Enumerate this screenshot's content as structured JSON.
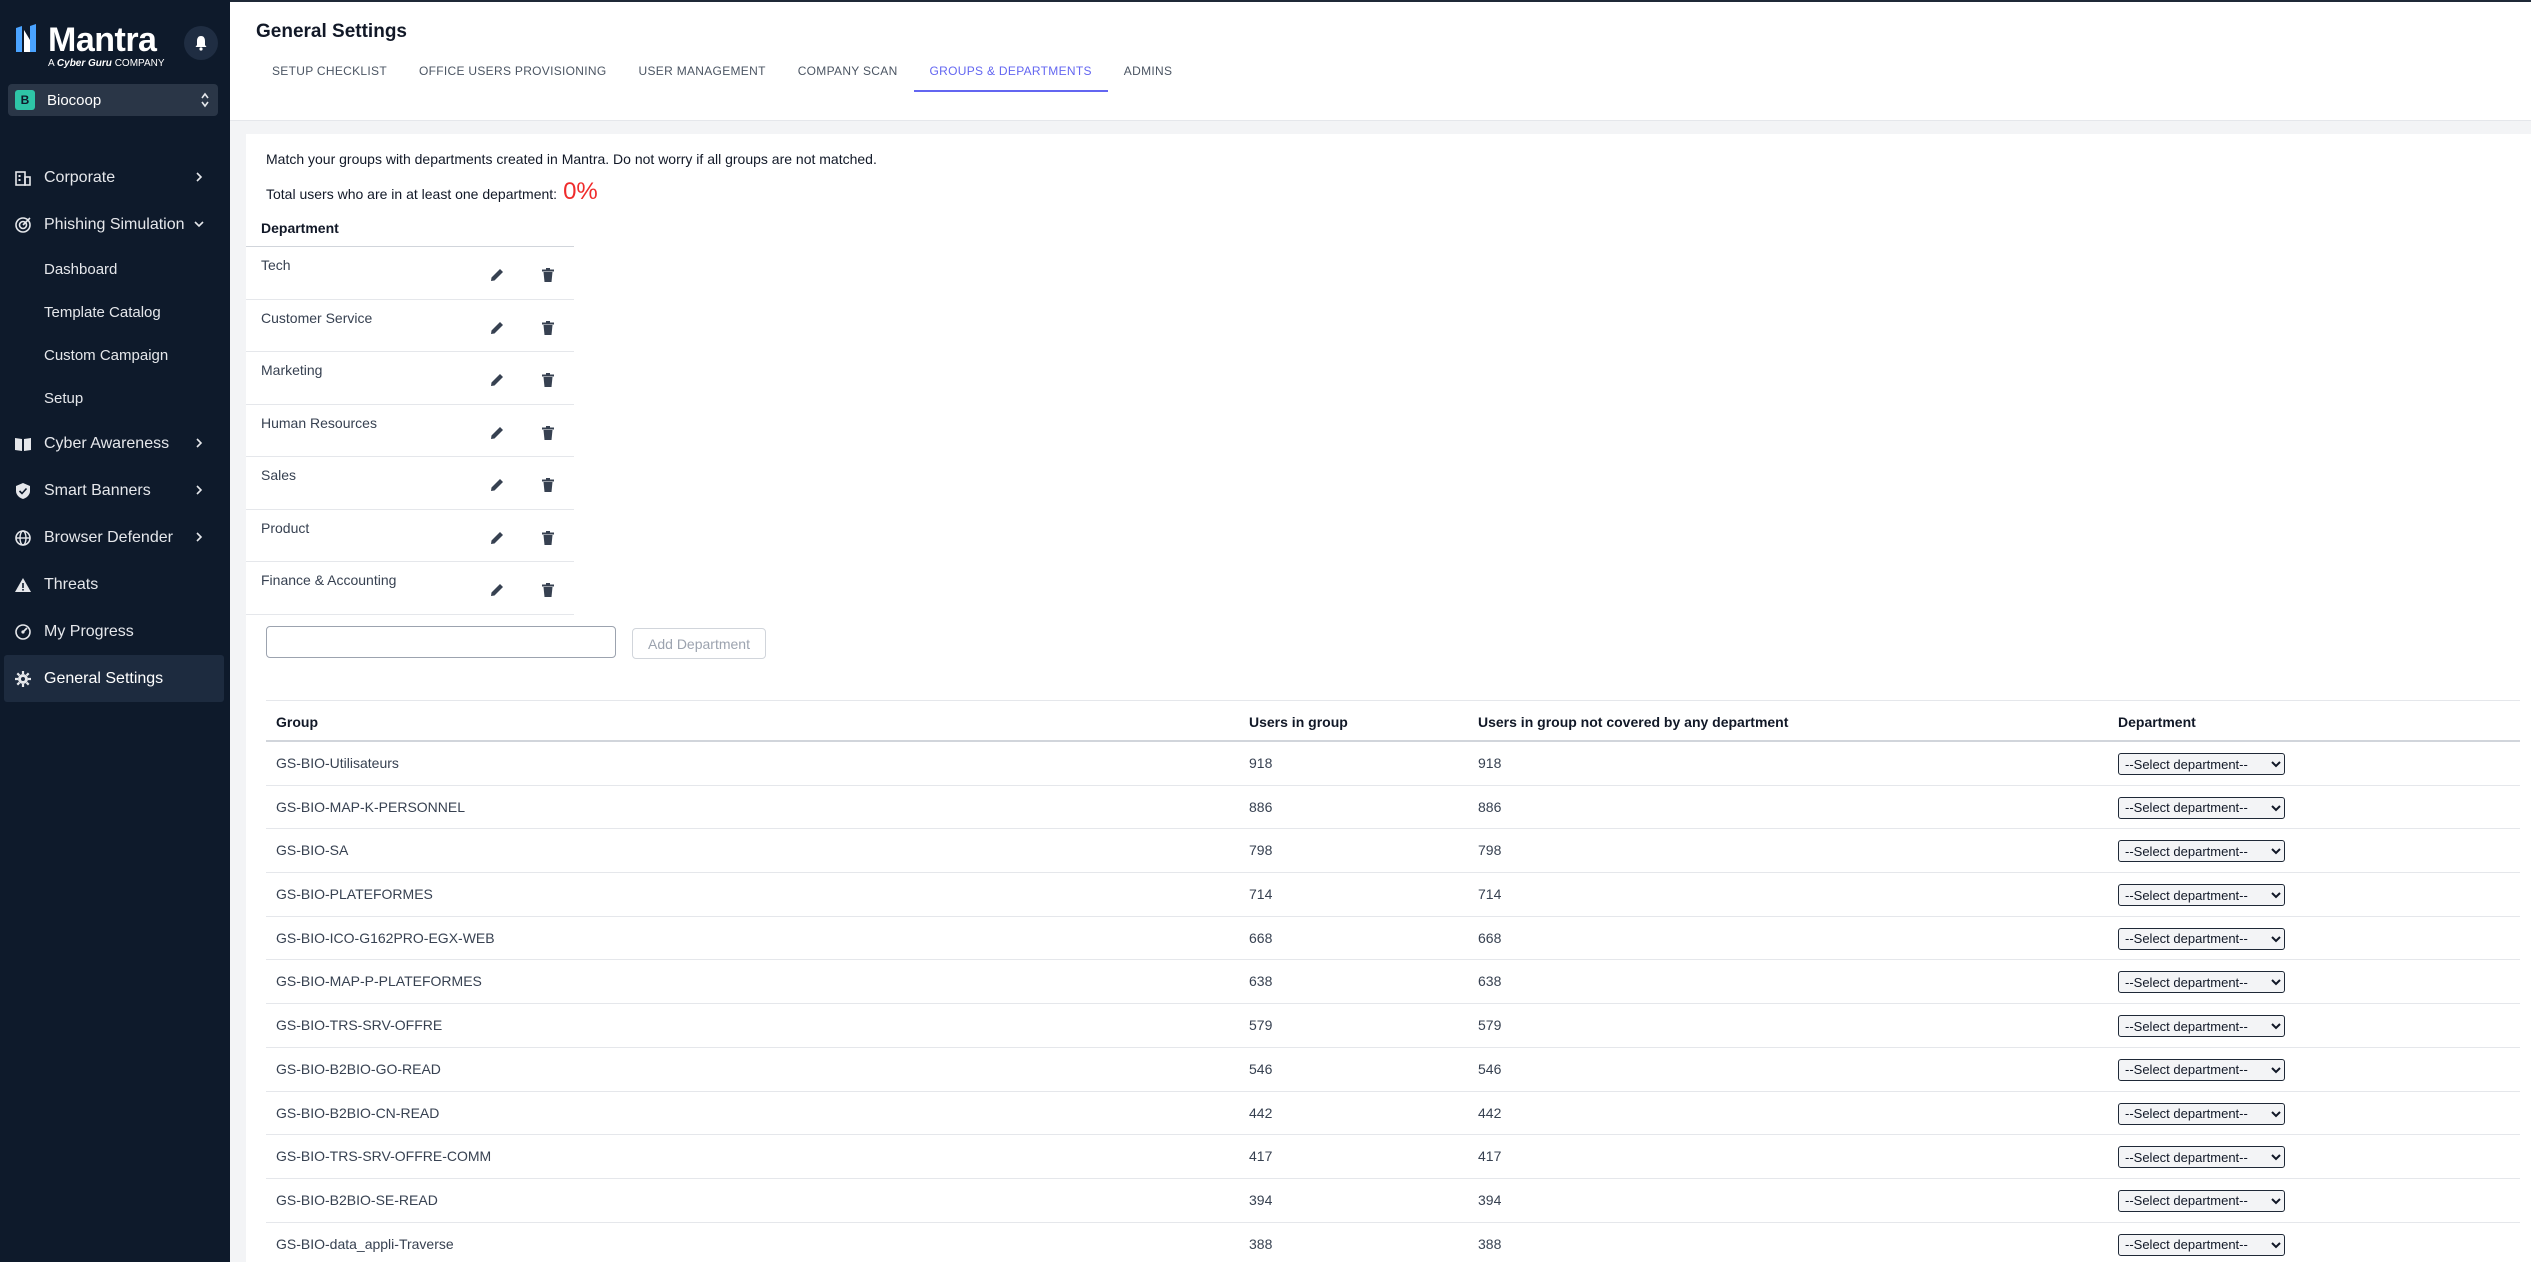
{
  "app": {
    "logo_text": "Mantra",
    "logo_sub_prefix": "A ",
    "logo_sub_brand": "Cyber Guru",
    "logo_sub_suffix": " COMPANY",
    "org": {
      "badge": "B",
      "name": "Biocoop"
    }
  },
  "colors": {
    "sidebar_bg": "#0e1a2b",
    "accent": "#6366f1",
    "percent_red": "#ef2b2b",
    "org_badge": "#2ec4a6"
  },
  "sidebar": {
    "items": [
      {
        "label": "Corporate",
        "icon": "building-icon"
      },
      {
        "label": "Phishing Simulation",
        "icon": "target-icon"
      },
      {
        "label": "Cyber Awareness",
        "icon": "book-icon"
      },
      {
        "label": "Smart Banners",
        "icon": "shield-icon"
      },
      {
        "label": "Browser Defender",
        "icon": "globe-icon"
      },
      {
        "label": "Threats",
        "icon": "warning-icon"
      },
      {
        "label": "My Progress",
        "icon": "progress-icon"
      },
      {
        "label": "General Settings",
        "icon": "gear-icon"
      }
    ],
    "phishing_sub": [
      "Dashboard",
      "Template Catalog",
      "Custom Campaign",
      "Setup"
    ]
  },
  "header": {
    "title": "General Settings",
    "tabs": [
      "SETUP CHECKLIST",
      "OFFICE USERS PROVISIONING",
      "USER MANAGEMENT",
      "COMPANY SCAN",
      "GROUPS & DEPARTMENTS",
      "ADMINS"
    ],
    "active_tab": "GROUPS & DEPARTMENTS"
  },
  "main": {
    "intro": "Match your groups with departments created in Mantra. Do not worry if all groups are not matched.",
    "total_label": "Total users who are in at least one department:",
    "total_value": "0%",
    "dept_header": "Department",
    "departments": [
      "Tech",
      "Customer Service",
      "Marketing",
      "Human Resources",
      "Sales",
      "Product",
      "Finance & Accounting"
    ],
    "add_input_value": "",
    "add_button": "Add Department",
    "groups_headers": [
      "Group",
      "Users in group",
      "Users in group not covered by any department",
      "Department"
    ],
    "select_placeholder": "--Select department--",
    "groups": [
      {
        "name": "GS-BIO-Utilisateurs",
        "users": "918",
        "uncovered": "918"
      },
      {
        "name": "GS-BIO-MAP-K-PERSONNEL",
        "users": "886",
        "uncovered": "886"
      },
      {
        "name": "GS-BIO-SA",
        "users": "798",
        "uncovered": "798"
      },
      {
        "name": "GS-BIO-PLATEFORMES",
        "users": "714",
        "uncovered": "714"
      },
      {
        "name": "GS-BIO-ICO-G162PRO-EGX-WEB",
        "users": "668",
        "uncovered": "668"
      },
      {
        "name": "GS-BIO-MAP-P-PLATEFORMES",
        "users": "638",
        "uncovered": "638"
      },
      {
        "name": "GS-BIO-TRS-SRV-OFFRE",
        "users": "579",
        "uncovered": "579"
      },
      {
        "name": "GS-BIO-B2BIO-GO-READ",
        "users": "546",
        "uncovered": "546"
      },
      {
        "name": "GS-BIO-B2BIO-CN-READ",
        "users": "442",
        "uncovered": "442"
      },
      {
        "name": "GS-BIO-TRS-SRV-OFFRE-COMM",
        "users": "417",
        "uncovered": "417"
      },
      {
        "name": "GS-BIO-B2BIO-SE-READ",
        "users": "394",
        "uncovered": "394"
      },
      {
        "name": "GS-BIO-data_appli-Traverse",
        "users": "388",
        "uncovered": "388"
      }
    ]
  }
}
